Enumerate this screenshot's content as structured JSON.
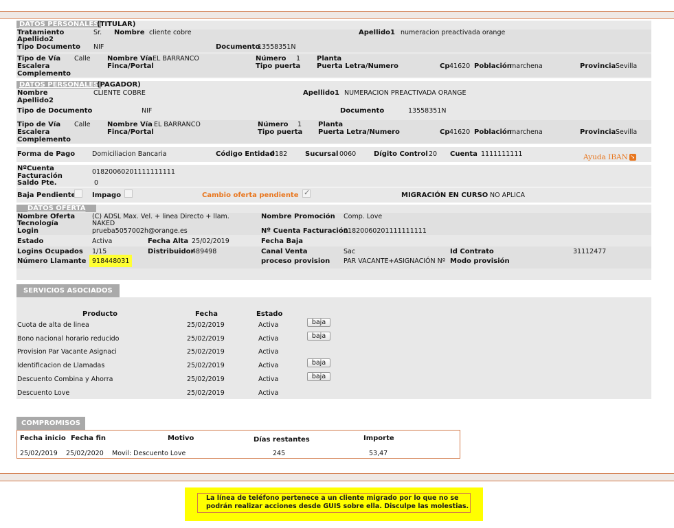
{
  "titular": {
    "header": "DATOS PERSONALES",
    "sub": "(TITULAR)",
    "tratamiento_lbl": "Tratamiento",
    "tratamiento": "Sr.",
    "nombre_lbl": "Nombre",
    "nombre": "cliente cobre",
    "apellido1_lbl": "Apellido1",
    "apellido1": "numeracion preactivada orange",
    "apellido2_lbl": "Apellido2",
    "tipodoc_lbl": "Tipo Documento",
    "tipodoc": "NIF",
    "documento_lbl": "Documento",
    "documento": "13558351N",
    "tipovia_lbl": "Tipo de Vía",
    "tipovia": "Calle",
    "nombrevia_lbl": "Nombre Vía",
    "nombrevia": "EL BARRANCO",
    "numero_lbl": "Número",
    "numero": "1",
    "planta_lbl": "Planta",
    "escalera_lbl": "Escalera",
    "finca_lbl": "Finca/Portal",
    "tipopuerta_lbl": "Tipo puerta",
    "puerta_lbl": "Puerta Letra/Numero",
    "cp_lbl": "Cp",
    "cp": "41620",
    "poblacion_lbl": "Población",
    "poblacion": "marchena",
    "provincia_lbl": "Provincia",
    "provincia": "Sevilla",
    "complemento_lbl": "Complemento"
  },
  "pagador": {
    "header": "DATOS PERSONALES",
    "sub": "(PAGADOR)",
    "nombre_lbl": "Nombre",
    "nombre": "CLIENTE COBRE",
    "apellido1_lbl": "Apellido1",
    "apellido1": "NUMERACION PREACTIVADA ORANGE",
    "apellido2_lbl": "Apellido2",
    "tipodoc_lbl": "Tipo de Documento",
    "tipodoc": "NIF",
    "documento_lbl": "Documento",
    "documento": "13558351N",
    "tipovia_lbl": "Tipo de Vía",
    "tipovia": "Calle",
    "nombrevia_lbl": "Nombre Vía",
    "nombrevia": "EL BARRANCO",
    "numero_lbl": "Número",
    "numero": "1",
    "planta_lbl": "Planta",
    "escalera_lbl": "Escalera",
    "finca_lbl": "Finca/Portal",
    "tipopuerta_lbl": "Tipo puerta",
    "puerta_lbl": "Puerta Letra/Numero",
    "cp_lbl": "Cp",
    "cp": "41620",
    "poblacion_lbl": "Población",
    "poblacion": "marchena",
    "provincia_lbl": "Provincia",
    "provincia": "Sevilla",
    "complemento_lbl": "Complemento"
  },
  "pago": {
    "forma_lbl": "Forma de Pago",
    "forma": "Domiciliacion Bancaria",
    "entidad_lbl": "Código Entidad",
    "entidad": "0182",
    "sucursal_lbl": "Sucursal",
    "sucursal": "0060",
    "digito_lbl": "Dígito Control",
    "digito": "20",
    "cuenta_lbl": "Cuenta",
    "cuenta": "1111111111",
    "ayuda_iban": "Ayuda IBAN",
    "ncuenta_lbl1": "NºCuenta",
    "ncuenta_lbl2": "Facturación",
    "ncuenta": "01820060201111111111",
    "saldo_lbl": "Saldo Pte.",
    "saldo": "0",
    "baja_lbl": "Baja Pendiente",
    "impago_lbl": "Impago",
    "cambio_lbl": "Cambio oferta pendiente",
    "migracion_lbl": "MIGRACIÓN EN CURSO",
    "migracion": "NO APLICA"
  },
  "oferta": {
    "header": "DATOS OFERTA",
    "nombre_lbl": "Nombre Oferta",
    "nombre": "(C) ADSL Max. Vel. + linea Directo + llam.",
    "promocion_lbl": "Nombre Promoción",
    "promocion": "Comp. Love",
    "tecnologia_lbl": "Tecnología",
    "tecnologia": "NAKED",
    "login_lbl": "Login",
    "login": "prueba5057002h@orange.es",
    "ncuenta_lbl": "Nº Cuenta Facturación",
    "ncuenta": "01820060201111111111",
    "estado_lbl": "Estado",
    "estado": "Activa",
    "fechaalta_lbl": "Fecha Alta",
    "fechaalta": "25/02/2019",
    "fechabaja_lbl": "Fecha Baja",
    "logins_lbl": "Logins Ocupados",
    "logins": "1/15",
    "distribuidor_lbl": "Distribuidor",
    "distribuidor": "489498",
    "canal_lbl": "Canal Venta",
    "canal": "Sac",
    "idcontrato_lbl": "Id Contrato",
    "idcontrato": "31112477",
    "numllamante_lbl": "Número Llamante",
    "numllamante": "918448031",
    "proceso_lbl": "proceso provision",
    "proceso": "PAR VACANTE+ASIGNACIÓN Nº",
    "modo_lbl": "Modo provisión"
  },
  "servicios": {
    "header": "SERVICIOS ASOCIADOS",
    "col_producto": "Producto",
    "col_fecha": "Fecha",
    "col_estado": "Estado",
    "baja_label": "baja",
    "rows": [
      {
        "producto": "Cuota de alta de linea",
        "fecha": "25/02/2019",
        "estado": "Activa",
        "baja": true
      },
      {
        "producto": "Bono nacional horario reducido",
        "fecha": "25/02/2019",
        "estado": "Activa",
        "baja": true
      },
      {
        "producto": "Provision Par Vacante Asignaci",
        "fecha": "25/02/2019",
        "estado": "Activa",
        "baja": false
      },
      {
        "producto": "Identificacion de Llamadas",
        "fecha": "25/02/2019",
        "estado": "Activa",
        "baja": true
      },
      {
        "producto": "Descuento Combina y Ahorra",
        "fecha": "25/02/2019",
        "estado": "Activa",
        "baja": true
      },
      {
        "producto": "Descuento Love",
        "fecha": "25/02/2019",
        "estado": "Activa",
        "baja": false
      }
    ]
  },
  "compromisos": {
    "header": "COMPROMISOS",
    "col_inicio": "Fecha inicio",
    "col_fin": "Fecha fin",
    "col_motivo": "Motivo",
    "col_dias": "Días restantes",
    "col_importe": "Importe",
    "rows": [
      {
        "inicio": "25/02/2019",
        "fin": "25/02/2020",
        "motivo": "Movil: Descuento Love",
        "dias": "245",
        "importe": "53,47"
      }
    ]
  },
  "notice": {
    "text": "La línea de teléfono pertenece a un cliente migrado por lo que no se podrán realizar acciones desde GUIS sobre ella. Disculpe las molestias."
  },
  "colors": {
    "accent": "#e8761e",
    "border": "#d27a4a",
    "band": "#e8e8e8",
    "header_bg": "#a9a9a9",
    "highlight": "#ffff33"
  }
}
